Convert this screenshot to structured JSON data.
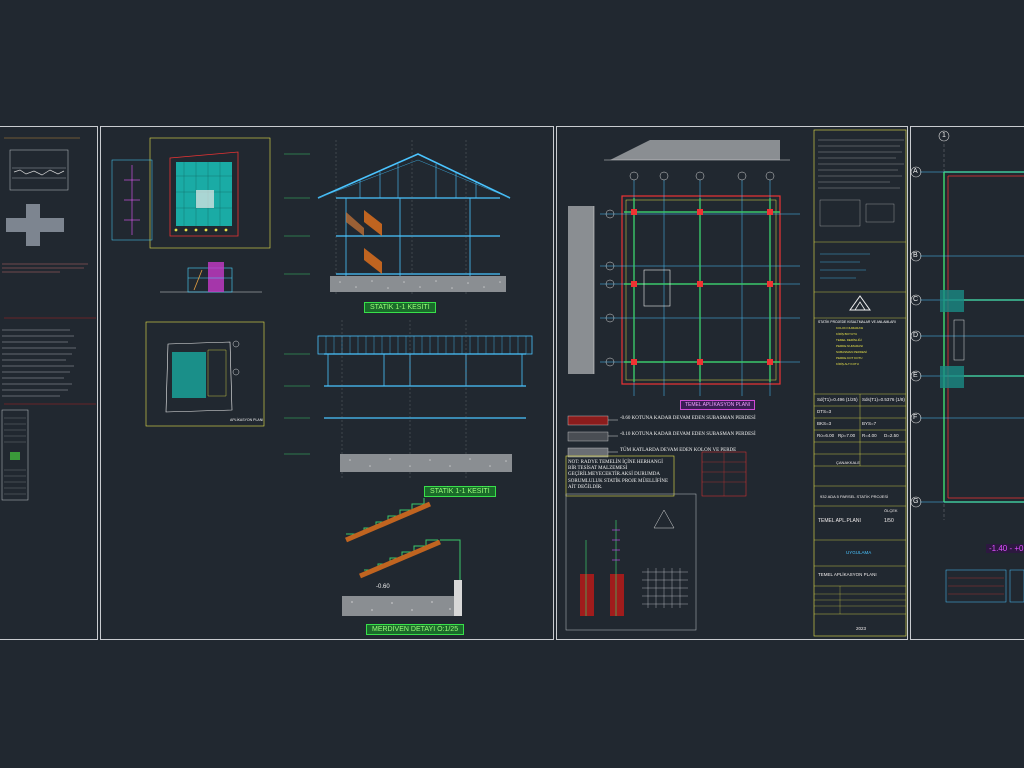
{
  "section_titles": {
    "statik_1": "STATİK 1-1 KESİTİ",
    "statik_2": "STATİK 1-1 KESİTİ",
    "merdiven": "MERDİVEN DETAYI Ö:1/25",
    "aplikasyon": "APLİKASYON PLANI",
    "radye": "TEMEL APLİKASYON PLANI"
  },
  "notes": {
    "kot_1": "-0.60 KOTUNA KADAR DEVAM EDEN SUBASMAN PERDESİ",
    "kot_2": "-0.10 KOTUNA KADAR DEVAM EDEN SUBASMAN PERDESİ",
    "kot_3": "TÜM KATLARDA DEVAM  EDEN KOLON VE PERDE",
    "not_radye": "NOT: RADYE TEMELİN İÇİNE HERHANGİ BİR TESİSAT MALZEMESİ GEÇİRİLMEYECEKTİR.AKSİ DURUMDA SORUMLULUK STATİK PROJE MÜELLİFİNE AİT DEĞİLDİR."
  },
  "elevation_mark": "-0.60",
  "right_elevation": "-1.40 - +0",
  "axis_labels": [
    "A",
    "B",
    "C",
    "D",
    "E",
    "F",
    "G"
  ],
  "axis_number": "1",
  "title_block": {
    "project_type": "STATİK PROJEDE KISALTMALAR VE ANLAMLARI",
    "sd_1": "Sd(T1)=0.496 (1/25)",
    "sd_2": "Sds(T1)=0.5376 (1/8)",
    "dtd": "DTS=3",
    "bys": "BYS=7",
    "bkg": "BKS=3",
    "r": "R=4.00",
    "d": "D=2.50",
    "ro": "Ro=6.00",
    "rp": "Rp=7.00",
    "yer": "ÇANAKKALE",
    "ada": "932 ADA 5 PARSEL STATİK PROJESİ",
    "olcek_label": "ÖLÇEK",
    "plan_name": "TEMEL APL.PLANI",
    "olcek": "1/50",
    "uygulama": "UYGULAMA",
    "plan_name_2": "TEMEL APLİKASYON PLANI",
    "year": "2023"
  },
  "legend_items": [
    "KOLON NUMARASI",
    "KİRİŞ BOYUTU",
    "TEMEL DERİNLİĞİ",
    "PERDE NUMARASI",
    "SUBASMAN PERDESİ",
    "PERDE KOT KOTU",
    "KİRİŞ ALT KOTU"
  ]
}
